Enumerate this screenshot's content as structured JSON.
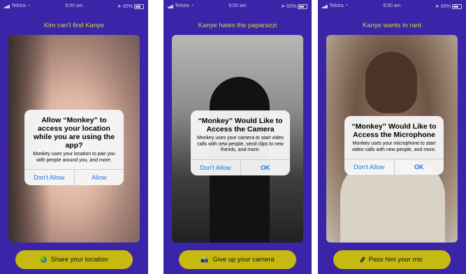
{
  "status_bar": {
    "carrier": "Telstra",
    "time": "9:50 am",
    "battery": "65%"
  },
  "screens": [
    {
      "title": "Kim can't find Kanye",
      "alert": {
        "title": "Allow “Monkey” to access your location while you are using the app?",
        "message": "Monkey uses your location to pair you with people around you, and more.",
        "buttons": [
          "Don't Allow",
          "Allow"
        ]
      },
      "cta_label": "Share your location",
      "cta_icon": "globe-icon"
    },
    {
      "title": "Kanye hates the paparazzi",
      "alert": {
        "title": "“Monkey” Would Like to Access the Camera",
        "message": "Monkey uses your camera to start video calls with new people, send clips to new friends, and more.",
        "buttons": [
          "Don't Allow",
          "OK"
        ]
      },
      "cta_label": "Give up your camera",
      "cta_icon": "camera-icon"
    },
    {
      "title": "Kanye wants to rant",
      "alert": {
        "title": "“Monkey” Would Like to Access the Microphone",
        "message": "Monkey uses your microphone to start video calls with new people, and more.",
        "buttons": [
          "Don't Allow",
          "OK"
        ]
      },
      "cta_label": "Pass him your mic",
      "cta_icon": "microphone-icon"
    }
  ],
  "colors": {
    "background": "#3a25a8",
    "title": "#d9d04a",
    "button": "#c6ba10",
    "alert_action": "#1a76e8"
  }
}
